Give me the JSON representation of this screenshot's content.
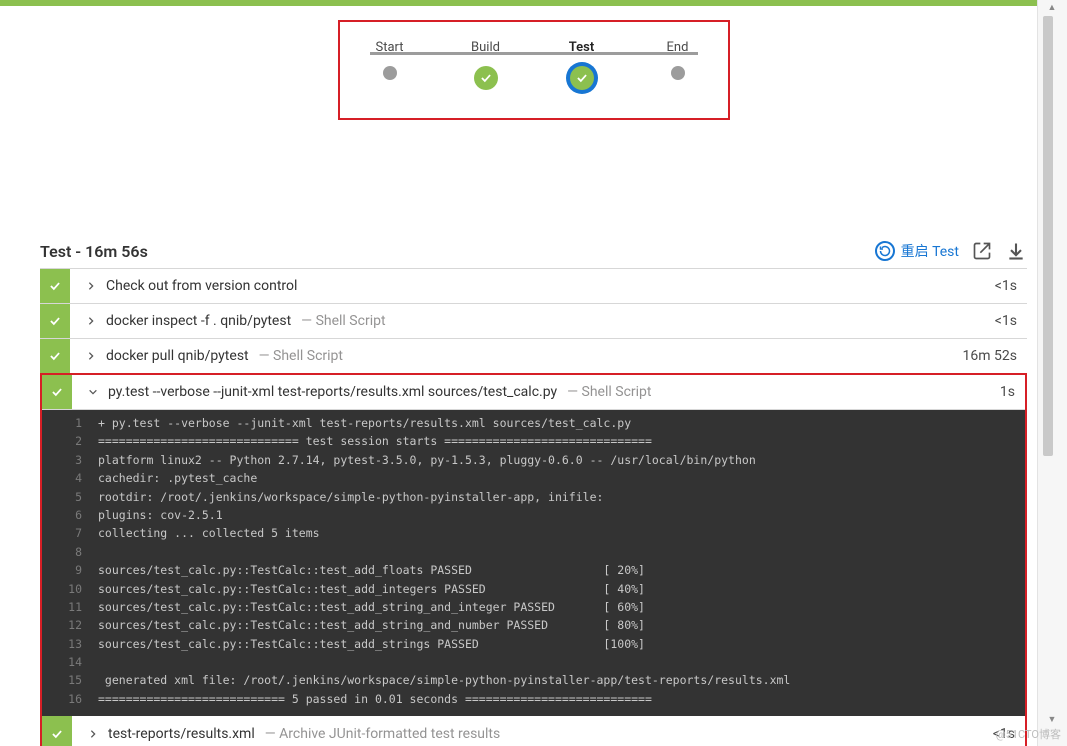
{
  "pipeline": {
    "stages": [
      {
        "label": "Start",
        "state": "done-small"
      },
      {
        "label": "Build",
        "state": "done-green"
      },
      {
        "label": "Test",
        "state": "active-green"
      },
      {
        "label": "End",
        "state": "done-small"
      }
    ]
  },
  "section": {
    "title": "Test - 16m 56s",
    "restart_label": "重启 Test"
  },
  "steps": [
    {
      "title": "Check out from version control",
      "sub": "",
      "time": "<1s",
      "expanded": false
    },
    {
      "title": "docker inspect -f . qnib/pytest",
      "sub": "— Shell Script",
      "time": "<1s",
      "expanded": false
    },
    {
      "title": "docker pull qnib/pytest",
      "sub": "— Shell Script",
      "time": "16m 52s",
      "expanded": false
    },
    {
      "title": "py.test --verbose --junit-xml test-reports/results.xml sources/test_calc.py",
      "sub": "— Shell Script",
      "time": "1s",
      "expanded": true
    },
    {
      "title": "test-reports/results.xml",
      "sub": "— Archive JUnit-formatted test results",
      "time": "<1s",
      "expanded": false
    }
  ],
  "console_lines": [
    "+ py.test --verbose --junit-xml test-reports/results.xml sources/test_calc.py",
    "============================= test session starts ==============================",
    "platform linux2 -- Python 2.7.14, pytest-3.5.0, py-1.5.3, pluggy-0.6.0 -- /usr/local/bin/python",
    "cachedir: .pytest_cache",
    "rootdir: /root/.jenkins/workspace/simple-python-pyinstaller-app, inifile:",
    "plugins: cov-2.5.1",
    "collecting ... collected 5 items",
    "",
    "sources/test_calc.py::TestCalc::test_add_floats PASSED                   [ 20%]",
    "sources/test_calc.py::TestCalc::test_add_integers PASSED                 [ 40%]",
    "sources/test_calc.py::TestCalc::test_add_string_and_integer PASSED       [ 60%]",
    "sources/test_calc.py::TestCalc::test_add_string_and_number PASSED        [ 80%]",
    "sources/test_calc.py::TestCalc::test_add_strings PASSED                  [100%]",
    "",
    " generated xml file: /root/.jenkins/workspace/simple-python-pyinstaller-app/test-reports/results.xml ",
    "=========================== 5 passed in 0.01 seconds ==========================="
  ],
  "watermark": "@51CTO博客"
}
